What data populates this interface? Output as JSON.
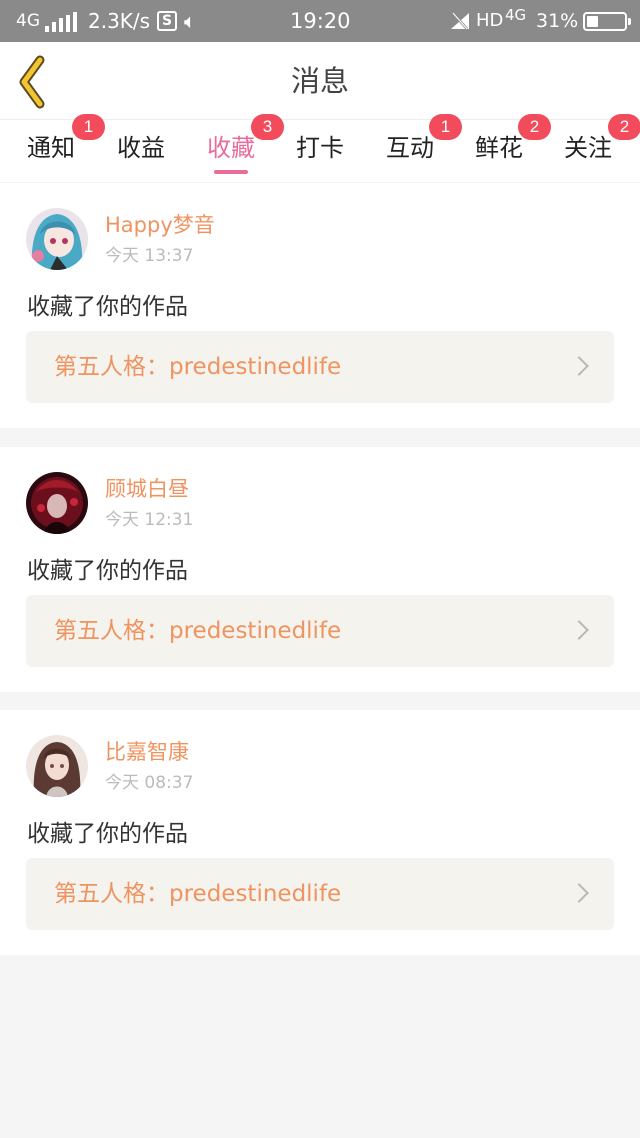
{
  "status_bar": {
    "network": "4G",
    "speed": "2.3K/s",
    "s_icon": "S",
    "time": "19:20",
    "hd": "HD",
    "net2": "4G",
    "battery_percent": "31%",
    "battery_level": 0.31,
    "icons": [
      "signal-icon",
      "s-app-icon",
      "volume-icon",
      "wifi-off-icon",
      "battery-icon"
    ]
  },
  "header": {
    "title": "消息",
    "back_icon": "chevron-left-icon",
    "accent": "#f3c533"
  },
  "tabs": [
    {
      "label": "通知",
      "badge": "1",
      "active": false
    },
    {
      "label": "收益",
      "badge": "",
      "active": false
    },
    {
      "label": "收藏",
      "badge": "3",
      "active": true
    },
    {
      "label": "打卡",
      "badge": "",
      "active": false
    },
    {
      "label": "互动",
      "badge": "1",
      "active": false
    },
    {
      "label": "鲜花",
      "badge": "2",
      "active": false
    },
    {
      "label": "关注",
      "badge": "2",
      "active": false
    }
  ],
  "colors": {
    "active_tab": "#e96c9b",
    "badge": "#f24b5b",
    "username": "#ef9460",
    "link_bg": "#f4f3ee"
  },
  "notifications": [
    {
      "user": "Happy梦音",
      "time": "今天 13:37",
      "action": "收藏了你的作品",
      "work": "第五人格：predestinedlife"
    },
    {
      "user": "顾城白昼",
      "time": "今天 12:31",
      "action": "收藏了你的作品",
      "work": "第五人格：predestinedlife"
    },
    {
      "user": "比嘉智康",
      "time": "今天 08:37",
      "action": "收藏了你的作品",
      "work": "第五人格：predestinedlife"
    }
  ]
}
